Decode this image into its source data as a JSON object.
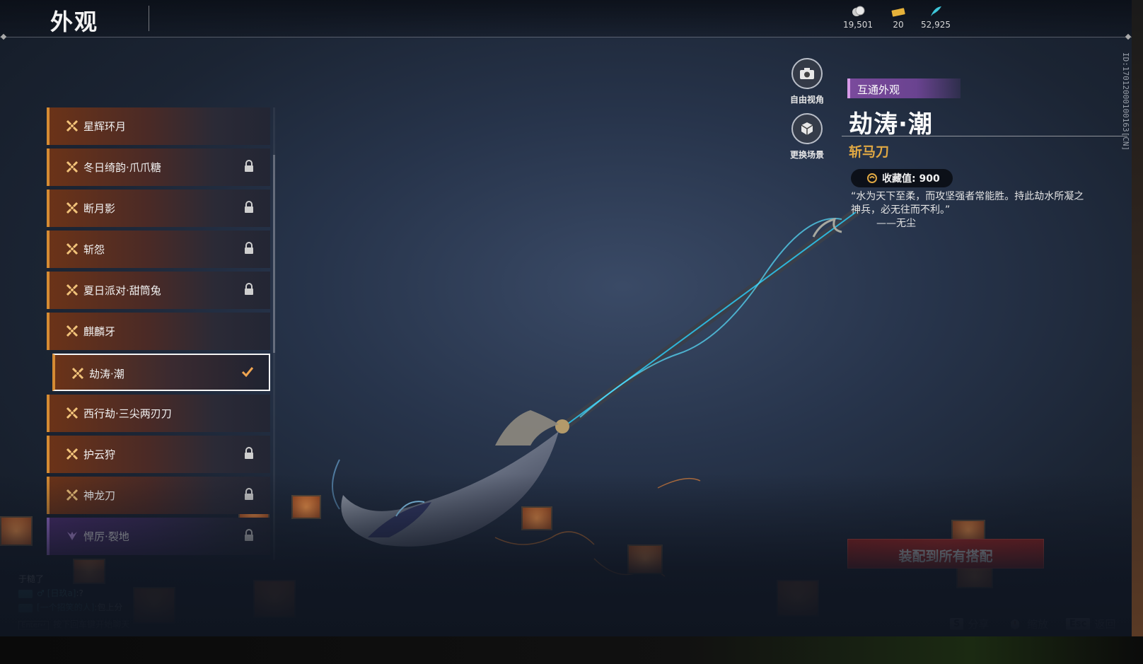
{
  "header": {
    "title": "外观",
    "currencies": [
      {
        "icon": "coin-icon",
        "value": "19,501"
      },
      {
        "icon": "ticket-icon",
        "value": "20"
      },
      {
        "icon": "feather-icon",
        "value": "52,925"
      }
    ]
  },
  "skins": [
    {
      "label": "星辉环月",
      "locked": false,
      "selected": false,
      "rarity": "orange"
    },
    {
      "label": "冬日绮韵·爪爪糖",
      "locked": true,
      "selected": false,
      "rarity": "orange"
    },
    {
      "label": "断月影",
      "locked": true,
      "selected": false,
      "rarity": "orange"
    },
    {
      "label": "斩怨",
      "locked": true,
      "selected": false,
      "rarity": "orange"
    },
    {
      "label": "夏日派对·甜筒兔",
      "locked": true,
      "selected": false,
      "rarity": "orange"
    },
    {
      "label": "麒麟牙",
      "locked": false,
      "selected": false,
      "rarity": "orange"
    },
    {
      "label": "劫涛·潮",
      "locked": false,
      "selected": true,
      "rarity": "orange"
    },
    {
      "label": "西行劫·三尖两刃刀",
      "locked": false,
      "selected": false,
      "rarity": "orange"
    },
    {
      "label": "护云狩",
      "locked": true,
      "selected": false,
      "rarity": "orange"
    },
    {
      "label": "神龙刀",
      "locked": true,
      "selected": false,
      "rarity": "orange"
    },
    {
      "label": "悍厉·裂地",
      "locked": true,
      "selected": false,
      "rarity": "purple"
    }
  ],
  "camera": {
    "free_view": "自由视角",
    "change_scene": "更换场景"
  },
  "detail": {
    "tag": "互通外观",
    "name": "劫涛·潮",
    "type": "斩马刀",
    "collect_label": "收藏值: 900",
    "quote": "“水为天下至柔，而攻坚强者常能胜。持此劫水所凝之神兵，必无往而不利。”",
    "quote_author": "——无尘",
    "id_text": "ID:17012000100163[CN]"
  },
  "actions": {
    "equip_all": "装配到所有搭配"
  },
  "hints": [
    {
      "key": "S",
      "label": "分享"
    },
    {
      "key": "",
      "label": "缩放"
    },
    {
      "key": "Esc",
      "label": "返回"
    }
  ],
  "chat": {
    "line0": "于糙了",
    "line1_name": "[日玖a]",
    "line1_text": ":?",
    "line2_name": "[一个招笑的人]",
    "line2_text": ":包上分",
    "enter_key": "Enter↵",
    "enter_prompt": "按下回车键开始聊天"
  },
  "colors": {
    "accent_orange": "#d58b33",
    "accent_gold": "#e0a843",
    "rarity_purple": "#a072d8",
    "equip_red": "#c42b25"
  }
}
